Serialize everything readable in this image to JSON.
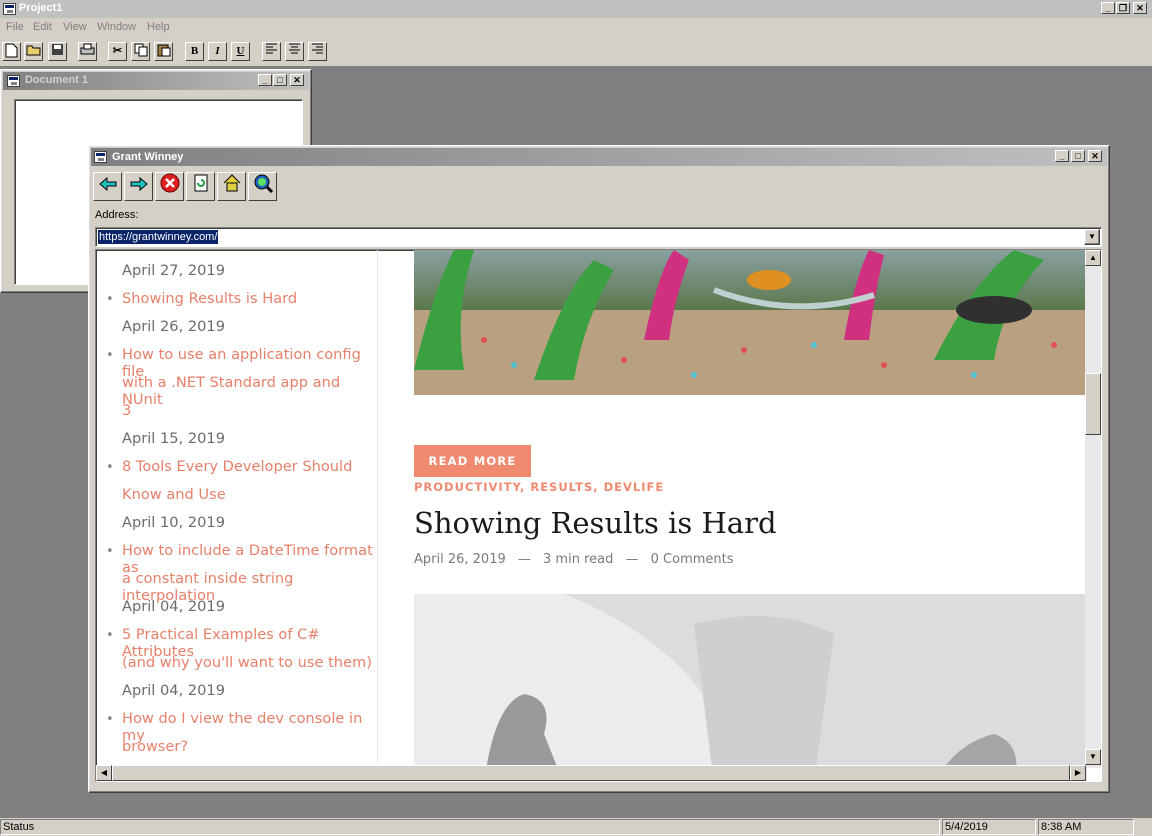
{
  "app": {
    "title": "Project1",
    "menu": [
      "File",
      "Edit",
      "View",
      "Window",
      "Help"
    ],
    "toolbar_text_buttons": {
      "bold": "B",
      "italic": "I",
      "underline": "U"
    }
  },
  "doc1": {
    "title": "Document 1"
  },
  "browser": {
    "title": "Grant Winney",
    "address_label": "Address:",
    "address_value": "https://grantwinney.com/",
    "sidebar": {
      "items": [
        {
          "date": "April 27, 2019"
        },
        {
          "title_lines": [
            "Showing Results is Hard"
          ],
          "date": "April 26, 2019"
        },
        {
          "title_lines": [
            "How to use an application config file",
            "with a .NET Standard app and NUnit",
            "3"
          ],
          "date": "April 15, 2019"
        },
        {
          "title_lines": [
            "8 Tools Every Developer Should",
            "Know and Use"
          ],
          "date": "April 10, 2019"
        },
        {
          "title_lines": [
            "How to include a DateTime format as",
            "a constant inside string interpolation"
          ],
          "date": "April 04, 2019"
        },
        {
          "title_lines": [
            "5 Practical Examples of C# Attributes",
            "(and why you'll want to use them)"
          ],
          "date": "April 04, 2019"
        },
        {
          "title_lines": [
            "How do I view the dev console in my",
            "browser?"
          ]
        }
      ]
    },
    "post": {
      "read_more": "READ MORE",
      "categories": [
        "PRODUCTIVITY",
        "RESULTS",
        "DEVLIFE"
      ],
      "category_sep": ", ",
      "title": "Showing Results is Hard",
      "date": "April 26, 2019",
      "meta_sep": "—",
      "read_time": "3 min read",
      "comments": "0 Comments"
    }
  },
  "status": {
    "text": "Status",
    "date": "5/4/2019",
    "time": "8:38 AM"
  },
  "colors": {
    "accent": "#ef8a70",
    "link": "#e8806a",
    "selection": "#0a246a"
  }
}
